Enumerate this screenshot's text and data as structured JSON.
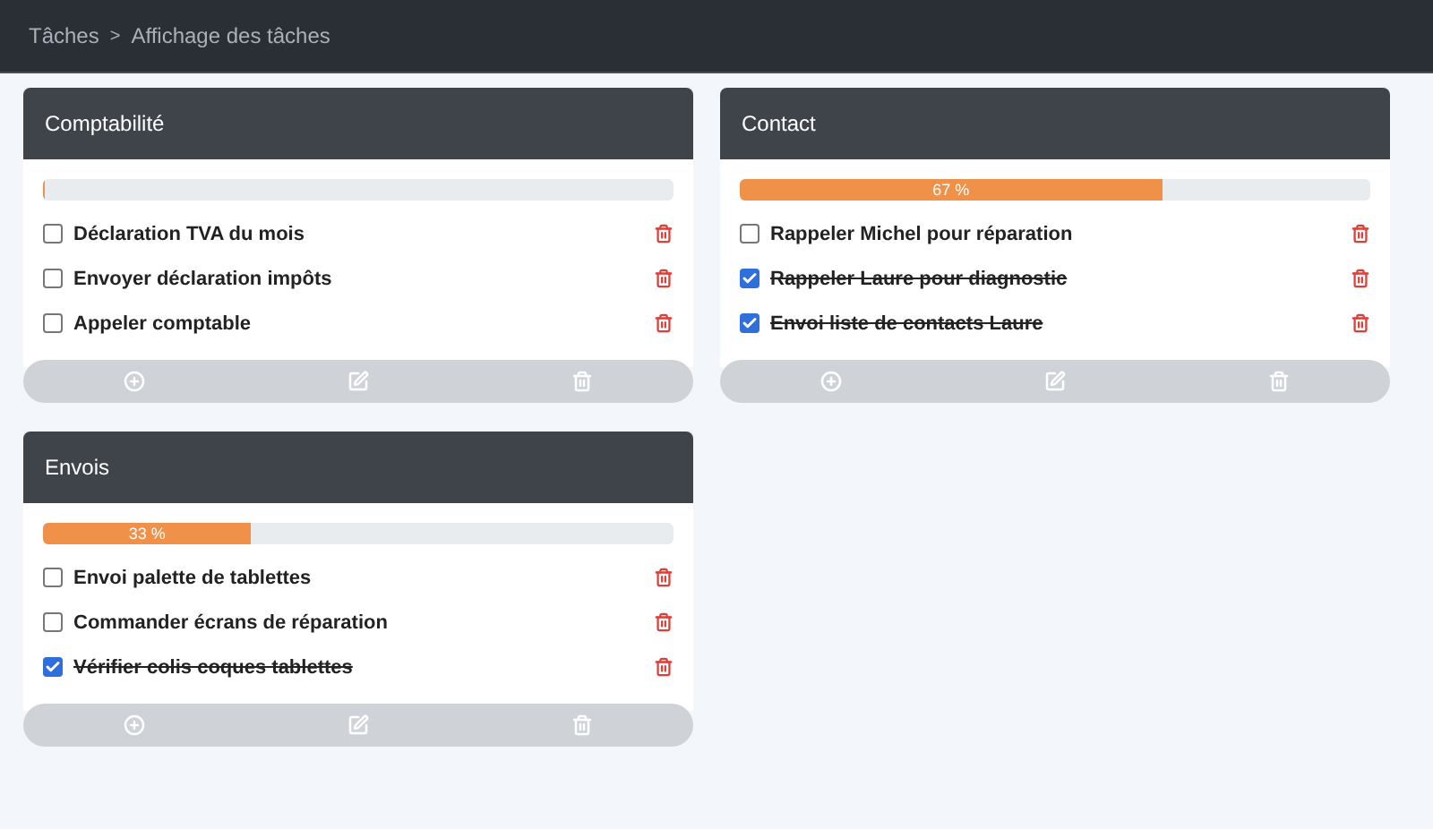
{
  "breadcrumb": {
    "items": [
      "Tâches",
      "Affichage des tâches"
    ],
    "separator": ">"
  },
  "lists": [
    {
      "title": "Comptabilité",
      "progress": {
        "level": 0
      },
      "tasks": [
        {
          "label": "Déclaration TVA du mois",
          "checked": false
        },
        {
          "label": "Envoyer déclaration impôts",
          "checked": false
        },
        {
          "label": "Appeler comptable",
          "checked": false
        }
      ]
    },
    {
      "title": "Contact",
      "progress": {
        "level": 0.67,
        "label": "67 %"
      },
      "tasks": [
        {
          "label": "Rappeler Michel pour réparation",
          "checked": false
        },
        {
          "label": "Rappeler Laure pour diagnostic",
          "checked": true
        },
        {
          "label": "Envoi liste de contacts Laure",
          "checked": true
        }
      ]
    },
    {
      "title": "Envois",
      "progress": {
        "level": 0.33,
        "label": "33 %"
      },
      "tasks": [
        {
          "label": "Envoi palette de tablettes",
          "checked": false
        },
        {
          "label": "Commander écrans de réparation",
          "checked": false
        },
        {
          "label": "Vérifier colis coques tablettes",
          "checked": true
        }
      ]
    }
  ]
}
